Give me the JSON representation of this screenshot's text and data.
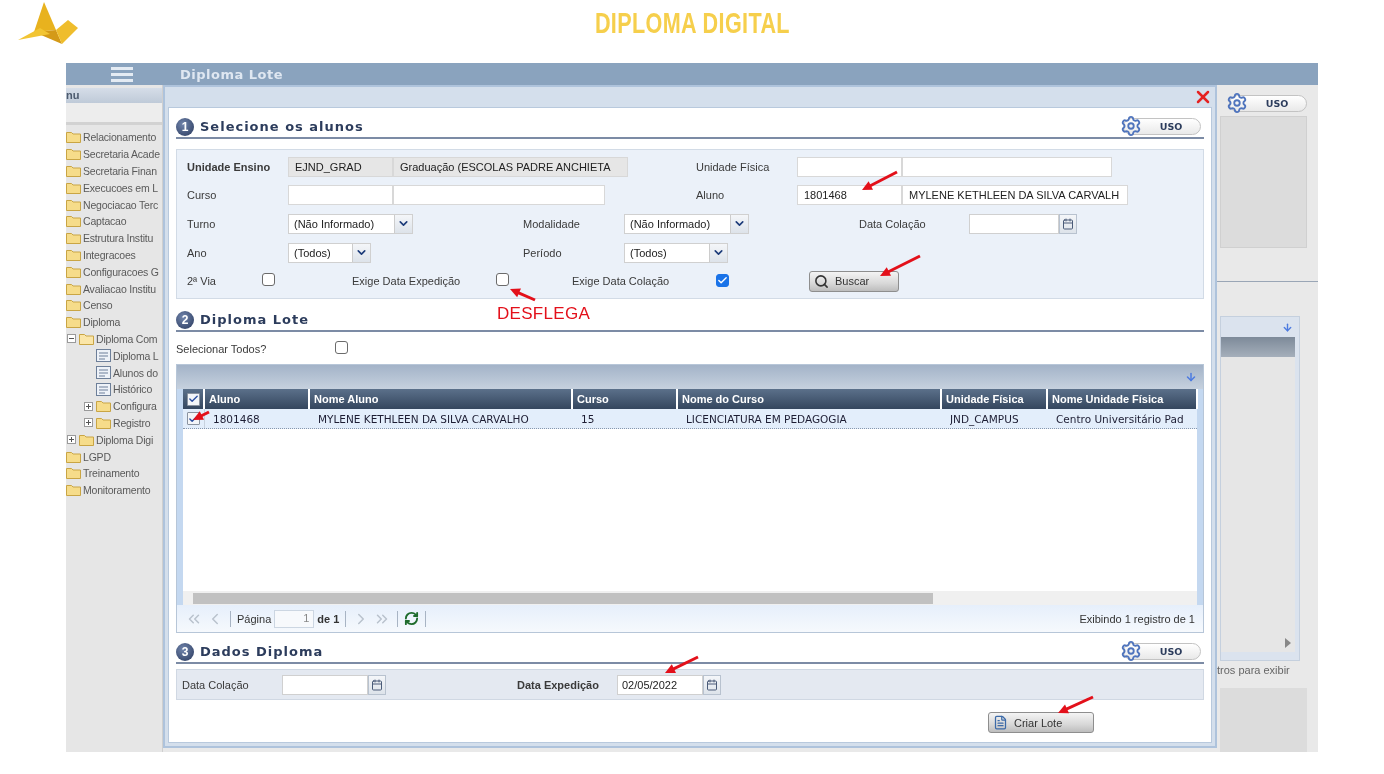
{
  "slide": {
    "title": "DIPLOMA DIGITAL"
  },
  "app": {
    "title": "Diploma Lote",
    "menu_header": "nu",
    "menu": [
      {
        "label": "Relacionamento",
        "kind": "folder"
      },
      {
        "label": "Secretaria Acade",
        "kind": "folder"
      },
      {
        "label": "Secretaria Finan",
        "kind": "folder"
      },
      {
        "label": "Execucoes em L",
        "kind": "folder"
      },
      {
        "label": "Negociacao Terc",
        "kind": "folder"
      },
      {
        "label": "Captacao",
        "kind": "folder"
      },
      {
        "label": "Estrutura Institu",
        "kind": "folder"
      },
      {
        "label": "Integracoes",
        "kind": "folder"
      },
      {
        "label": "Configuracoes G",
        "kind": "folder"
      },
      {
        "label": "Avaliacao Institu",
        "kind": "folder"
      },
      {
        "label": "Censo",
        "kind": "folder"
      },
      {
        "label": "Diploma",
        "kind": "folder",
        "children": [
          {
            "label": "Diploma Com",
            "kind": "folder",
            "expanded": true,
            "children": [
              {
                "label": "Diploma L",
                "kind": "page"
              },
              {
                "label": "Alunos do",
                "kind": "page"
              },
              {
                "label": "Histórico",
                "kind": "page"
              },
              {
                "label": "Configura",
                "kind": "folder",
                "expanded": false
              },
              {
                "label": "Registro",
                "kind": "folder",
                "expanded": false
              }
            ]
          },
          {
            "label": "Diploma Digi",
            "kind": "folder",
            "expanded": false
          }
        ]
      },
      {
        "label": "LGPD",
        "kind": "folder"
      },
      {
        "label": "Treinamento",
        "kind": "folder"
      },
      {
        "label": "Monitoramento",
        "kind": "folder"
      }
    ],
    "right_panel": {
      "uso": "USO",
      "status": "tros para exibir"
    }
  },
  "dialog": {
    "select_students": {
      "number": "1",
      "title": "Selecione os alunos",
      "uso": "USO",
      "unidade_ensino": {
        "label": "Unidade Ensino",
        "code": "EJND_GRAD",
        "name": "Graduação (ESCOLAS PADRE ANCHIETA"
      },
      "unidade_fisica": {
        "label": "Unidade Física"
      },
      "curso": {
        "label": "Curso"
      },
      "aluno": {
        "label": "Aluno",
        "code": "1801468",
        "name": "MYLENE KETHLEEN DA SILVA CARVALH"
      },
      "turno": {
        "label": "Turno",
        "value": "(Não Informado)"
      },
      "modalidade": {
        "label": "Modalidade",
        "value": "(Não Informado)"
      },
      "data_colacao": {
        "label": "Data Colação"
      },
      "ano": {
        "label": "Ano",
        "value": "(Todos)"
      },
      "periodo": {
        "label": "Período",
        "value": "(Todos)"
      },
      "checkboxes": [
        {
          "label": "2ª Via",
          "checked": false
        },
        {
          "label": "Exige Data Expedição",
          "checked": false
        },
        {
          "label": "Exige Data Colação",
          "checked": true
        }
      ],
      "search_button": "Buscar"
    },
    "batch": {
      "number": "2",
      "title": "Diploma Lote",
      "select_all": {
        "label": "Selecionar Todos?",
        "checked": false
      },
      "table": {
        "all_checked": true,
        "columns": [
          "Aluno",
          "Nome Aluno",
          "Curso",
          "Nome do Curso",
          "Unidade Física",
          "Nome Unidade Física"
        ],
        "rows": [
          {
            "checked": true,
            "selected": true,
            "cells": [
              "1801468",
              "MYLENE KETHLEEN DA SILVA CARVALHO",
              "15",
              "LICENCIATURA EM PEDAGOGIA",
              "JND_CAMPUS",
              "Centro Universitário Pad"
            ]
          }
        ]
      },
      "pager": {
        "page_label": "Página",
        "page": "1",
        "of": "de 1",
        "summary": "Exibindo 1 registro de 1"
      }
    },
    "diploma_data": {
      "number": "3",
      "title": "Dados Diploma",
      "uso": "USO",
      "data_colacao": {
        "label": "Data Colação"
      },
      "data_expedicao": {
        "label": "Data Expedição",
        "value": "02/05/2022"
      },
      "create_button": "Criar Lote"
    }
  },
  "annotations": {
    "note": "DESFLEGA"
  }
}
